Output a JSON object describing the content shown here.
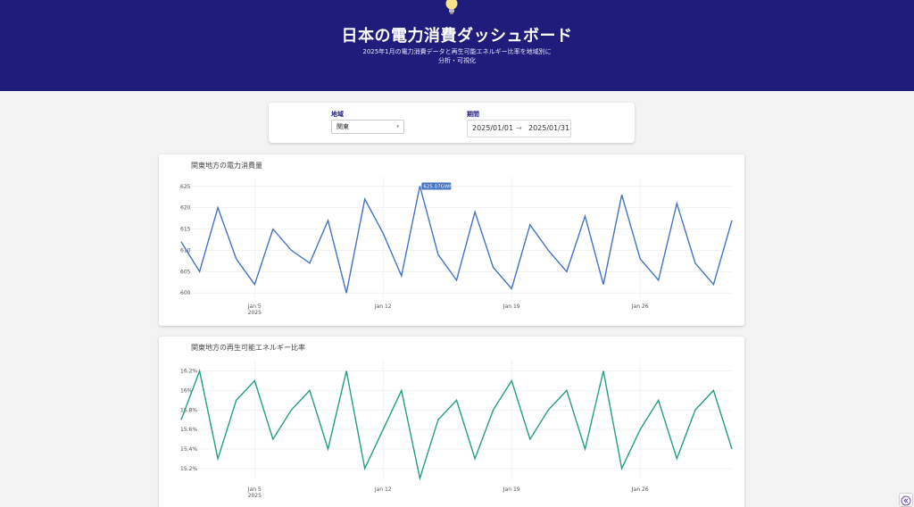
{
  "header": {
    "title": "日本の電力消費ダッシュボード",
    "subtitle_line1": "2025年1月の電力消費データと再生可能エネルギー比率を地域別に",
    "subtitle_line2": "分析・可視化"
  },
  "filters": {
    "region_label": "地域",
    "region_value": "関東",
    "period_label": "期間",
    "start_date": "2025/01/01",
    "arrow": "→",
    "end_date": "2025/01/31"
  },
  "colors": {
    "header_bg": "#1f1c7c",
    "consumption_line": "#4472c4",
    "renewable_line": "#239e84"
  },
  "icons": {
    "header": "lightbulb-icon",
    "sidebar_toggle": "chevron-double-left-icon"
  },
  "chart_data": [
    {
      "type": "line",
      "title": "関東地方の電力消費量",
      "x": [
        "2025-01-01",
        "2025-01-02",
        "2025-01-03",
        "2025-01-04",
        "2025-01-05",
        "2025-01-06",
        "2025-01-07",
        "2025-01-08",
        "2025-01-09",
        "2025-01-10",
        "2025-01-11",
        "2025-01-12",
        "2025-01-13",
        "2025-01-14",
        "2025-01-15",
        "2025-01-16",
        "2025-01-17",
        "2025-01-18",
        "2025-01-19",
        "2025-01-20",
        "2025-01-21",
        "2025-01-22",
        "2025-01-23",
        "2025-01-24",
        "2025-01-25",
        "2025-01-26",
        "2025-01-27",
        "2025-01-28",
        "2025-01-29",
        "2025-01-30",
        "2025-01-31"
      ],
      "values": [
        612,
        605,
        620,
        608,
        602,
        615,
        610,
        607,
        617,
        600,
        622,
        614,
        604,
        625.07,
        609,
        603,
        619,
        606,
        601,
        616,
        610,
        605,
        618,
        602,
        623,
        608,
        603,
        621,
        607,
        602,
        617
      ],
      "x_ticks": [
        {
          "date": "2025-01-05",
          "label": "Jan 5",
          "sublabel": "2025"
        },
        {
          "date": "2025-01-12",
          "label": "Jan 12",
          "sublabel": ""
        },
        {
          "date": "2025-01-19",
          "label": "Jan 19",
          "sublabel": ""
        },
        {
          "date": "2025-01-26",
          "label": "Jan 26",
          "sublabel": ""
        }
      ],
      "y_ticks": [
        600,
        605,
        610,
        615,
        620,
        625
      ],
      "ylim": [
        599,
        626
      ],
      "tick_suffix": "",
      "hover_label": "625.07GWh",
      "hover_index": 13,
      "grid": true
    },
    {
      "type": "line",
      "title": "関東地方の再生可能エネルギー比率",
      "x": [
        "2025-01-01",
        "2025-01-02",
        "2025-01-03",
        "2025-01-04",
        "2025-01-05",
        "2025-01-06",
        "2025-01-07",
        "2025-01-08",
        "2025-01-09",
        "2025-01-10",
        "2025-01-11",
        "2025-01-12",
        "2025-01-13",
        "2025-01-14",
        "2025-01-15",
        "2025-01-16",
        "2025-01-17",
        "2025-01-18",
        "2025-01-19",
        "2025-01-20",
        "2025-01-21",
        "2025-01-22",
        "2025-01-23",
        "2025-01-24",
        "2025-01-25",
        "2025-01-26",
        "2025-01-27",
        "2025-01-28",
        "2025-01-29",
        "2025-01-30",
        "2025-01-31"
      ],
      "values": [
        15.7,
        16.2,
        15.3,
        15.9,
        16.1,
        15.5,
        15.8,
        16.0,
        15.4,
        16.2,
        15.2,
        15.6,
        16.0,
        15.1,
        15.7,
        15.9,
        15.3,
        15.8,
        16.1,
        15.5,
        15.8,
        16.0,
        15.4,
        16.2,
        15.2,
        15.6,
        15.9,
        15.3,
        15.8,
        16.0,
        15.4
      ],
      "x_ticks": [
        {
          "date": "2025-01-05",
          "label": "Jan 5",
          "sublabel": "2025"
        },
        {
          "date": "2025-01-12",
          "label": "Jan 12",
          "sublabel": ""
        },
        {
          "date": "2025-01-19",
          "label": "Jan 19",
          "sublabel": ""
        },
        {
          "date": "2025-01-26",
          "label": "Jan 26",
          "sublabel": ""
        }
      ],
      "y_ticks": [
        15.2,
        15.4,
        15.6,
        15.8,
        16.0,
        16.2
      ],
      "y_tick_labels": [
        "15.2%",
        "15.4%",
        "15.6%",
        "15.8%",
        "16%",
        "16.2%"
      ],
      "ylim": [
        15.08,
        16.26
      ],
      "grid": true
    }
  ]
}
